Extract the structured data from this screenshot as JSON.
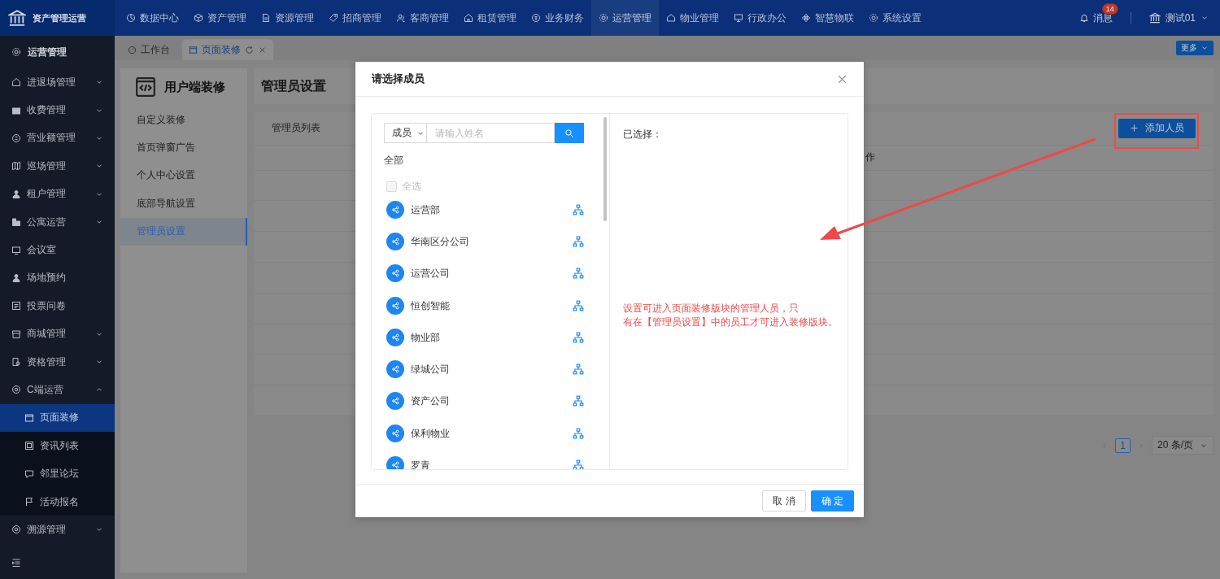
{
  "app": {
    "title": "资产管理运营"
  },
  "top_nav": [
    {
      "label": "数据中心",
      "selected": false
    },
    {
      "label": "资产管理",
      "selected": false
    },
    {
      "label": "资源管理",
      "selected": false
    },
    {
      "label": "招商管理",
      "selected": false
    },
    {
      "label": "客商管理",
      "selected": false
    },
    {
      "label": "租赁管理",
      "selected": false
    },
    {
      "label": "业务财务",
      "selected": false
    },
    {
      "label": "运营管理",
      "selected": true
    },
    {
      "label": "物业管理",
      "selected": false
    },
    {
      "label": "行政办公",
      "selected": false
    },
    {
      "label": "智慧物联",
      "selected": false
    },
    {
      "label": "系统设置",
      "selected": false
    }
  ],
  "notifications": {
    "label": "消息",
    "badge": "14"
  },
  "user": {
    "name": "测试01"
  },
  "sidebar": {
    "title": "运营管理",
    "items": [
      {
        "kind": "group",
        "label": "进退场管理",
        "expanded": false
      },
      {
        "kind": "group",
        "label": "收费管理",
        "expanded": false
      },
      {
        "kind": "group",
        "label": "营业额管理",
        "expanded": false
      },
      {
        "kind": "group",
        "label": "巡场管理",
        "expanded": false
      },
      {
        "kind": "group",
        "label": "租户管理",
        "expanded": false
      },
      {
        "kind": "group",
        "label": "公寓运营",
        "expanded": false
      },
      {
        "kind": "link",
        "label": "会议室"
      },
      {
        "kind": "link",
        "label": "场地预约"
      },
      {
        "kind": "link",
        "label": "投票问卷"
      },
      {
        "kind": "group",
        "label": "商城管理",
        "expanded": false
      },
      {
        "kind": "group",
        "label": "资格管理",
        "expanded": false
      },
      {
        "kind": "group",
        "label": "C端运营",
        "expanded": true,
        "children": [
          {
            "label": "页面装修",
            "selected": true
          },
          {
            "label": "资讯列表",
            "selected": false
          },
          {
            "label": "邻里论坛",
            "selected": false
          },
          {
            "label": "活动报名",
            "selected": false
          }
        ]
      },
      {
        "kind": "group",
        "label": "溯源管理",
        "expanded": false
      }
    ]
  },
  "tabs": [
    {
      "label": "工作台",
      "selected": false
    },
    {
      "label": "页面装修",
      "selected": true
    }
  ],
  "more_button": "更多",
  "decor_panel": {
    "title": "用户端装修",
    "items": [
      {
        "label": "自定义装修",
        "selected": false
      },
      {
        "label": "首页弹窗广告",
        "selected": false
      },
      {
        "label": "个人中心设置",
        "selected": false
      },
      {
        "label": "底部导航设置",
        "selected": false
      },
      {
        "label": "管理员设置",
        "selected": true
      }
    ]
  },
  "page": {
    "title": "管理员设置",
    "list_title": "管理员列表",
    "add_button": "添加人员",
    "table": {
      "column_2": "作"
    },
    "pagination": {
      "current": "1",
      "page_size": "20 条/页"
    }
  },
  "dialog": {
    "title": "请选择成员",
    "search": {
      "scope": "成员",
      "placeholder": "请输入姓名"
    },
    "tree_root": "全部",
    "select_all": {
      "label": "全选",
      "checked": false,
      "disabled": true
    },
    "orgs": [
      "运营部",
      "华南区分公司",
      "运营公司",
      "恒创智能",
      "物业部",
      "绿城公司",
      "资产公司",
      "保利物业",
      "罗青"
    ],
    "selected_label": "已选择：",
    "note_lines": [
      "设置可进入页面装修版块的管理人员，只",
      "有在【管理员设置】中的员工才可进入装修版块。"
    ],
    "buttons": [
      {
        "kind": "cancel",
        "label": "取 消"
      },
      {
        "kind": "confirm",
        "label": "确 定"
      }
    ]
  }
}
